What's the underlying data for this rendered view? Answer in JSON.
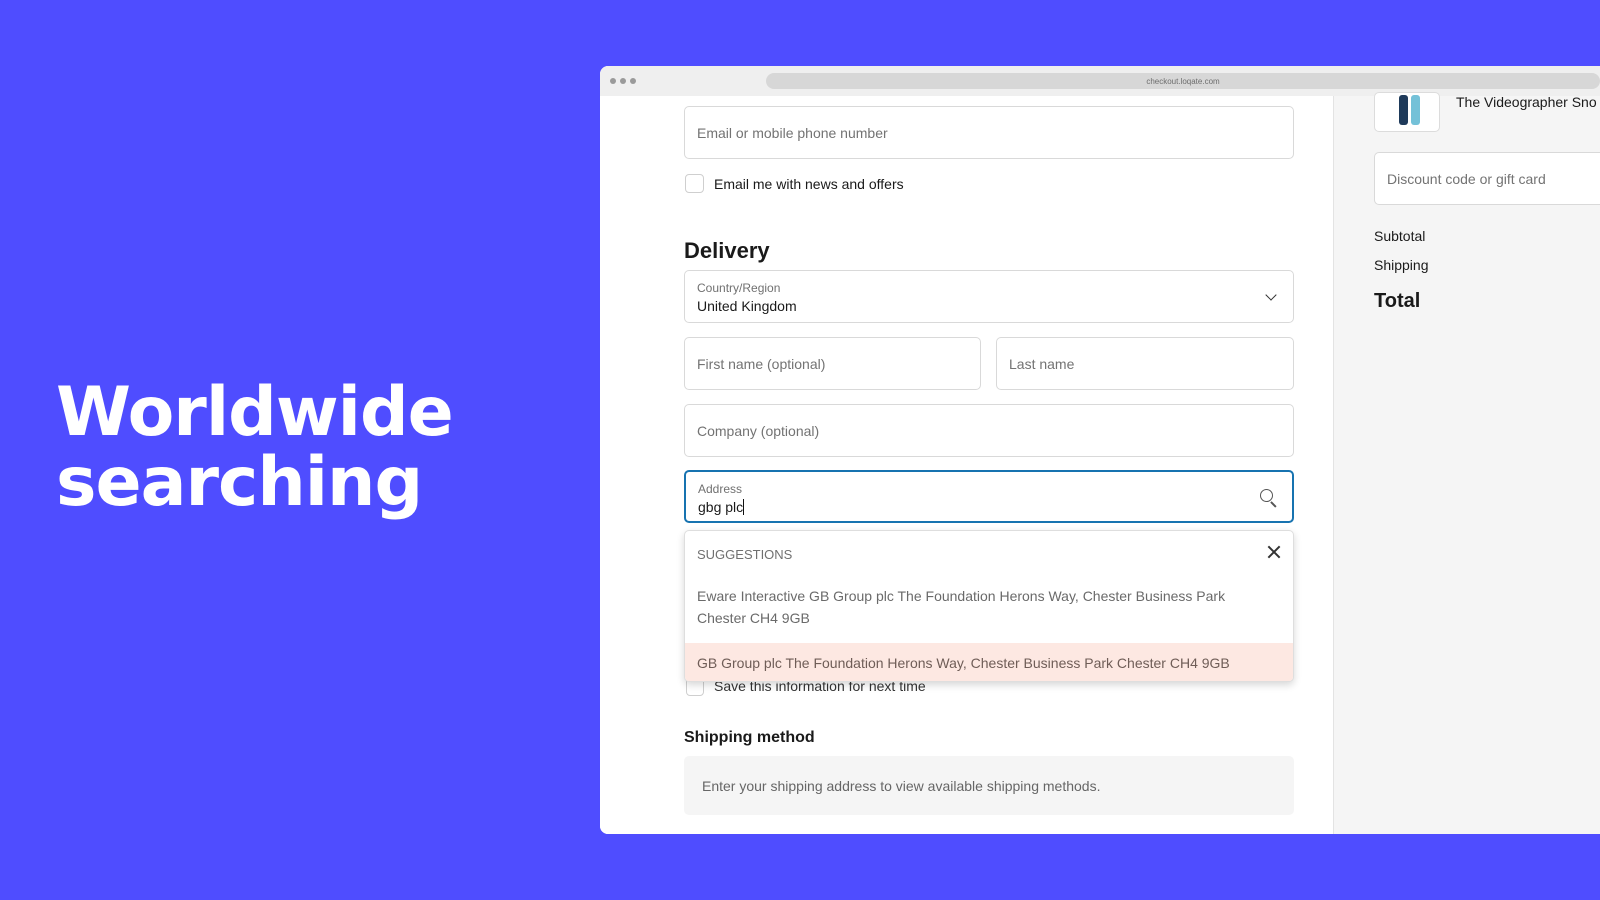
{
  "headline": {
    "line1": "Worldwide",
    "line2": "searching"
  },
  "browser": {
    "url": "checkout.loqate.com"
  },
  "form": {
    "contact_placeholder": "Email or mobile phone number",
    "news_label": "Email me with news and offers",
    "delivery_heading": "Delivery",
    "country": {
      "label": "Country/Region",
      "value": "United Kingdom"
    },
    "first_name_placeholder": "First name (optional)",
    "last_name_placeholder": "Last name",
    "company_placeholder": "Company (optional)",
    "address": {
      "label": "Address",
      "value": "gbg plc"
    },
    "save_info_label": "Save this information for next time",
    "shipping_heading": "Shipping method",
    "shipping_note": "Enter your shipping address to view available shipping methods."
  },
  "suggestions": {
    "heading": "SUGGESTIONS",
    "items": [
      {
        "line1": "Eware Interactive GB Group plc The Foundation Herons Way, Chester Business Park",
        "line2": "Chester CH4 9GB"
      },
      {
        "line1": "GB Group plc The Foundation Herons Way, Chester Business Park Chester CH4 9GB"
      }
    ]
  },
  "summary": {
    "product_name": "The Videographer Sno",
    "discount_placeholder": "Discount code or gift card",
    "subtotal_label": "Subtotal",
    "shipping_label": "Shipping",
    "total_label": "Total"
  },
  "colors": {
    "background": "#4f4dff",
    "focus": "#1773b0",
    "highlight": "#fde8e2"
  }
}
